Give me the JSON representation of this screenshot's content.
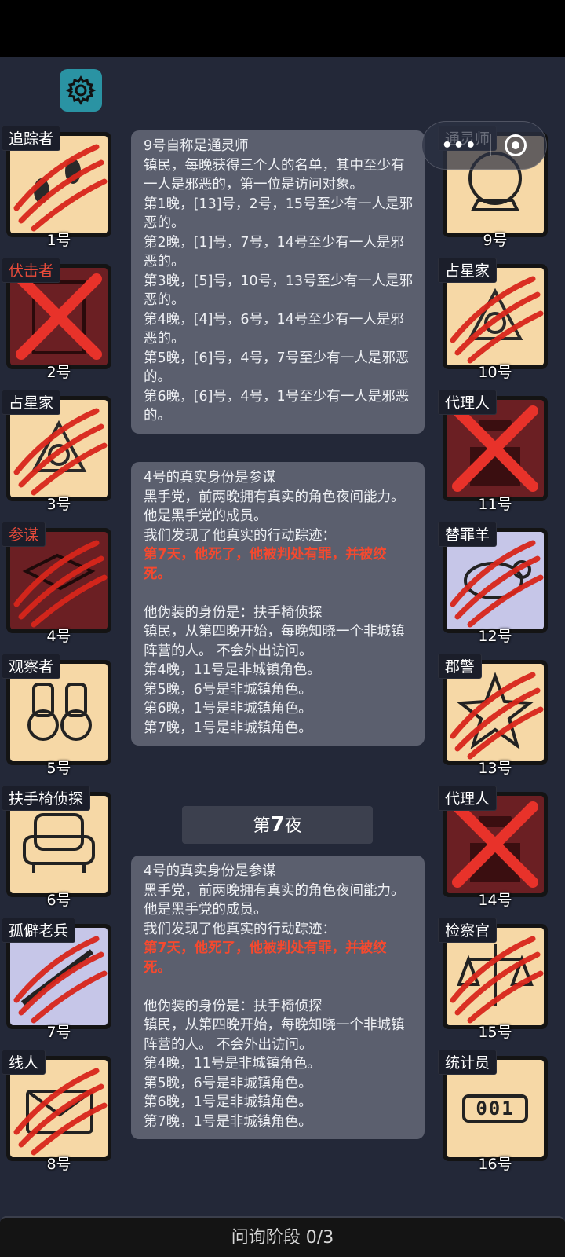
{
  "capsule": {
    "dots": "•••"
  },
  "left_cards": [
    {
      "role": "追踪者",
      "num": "1号",
      "red": false,
      "bg": "tan",
      "icon": "footprints-icon",
      "mark": "claw"
    },
    {
      "role": "伏击者",
      "num": "2号",
      "red": true,
      "bg": "red",
      "icon": "door-icon",
      "mark": "cross"
    },
    {
      "role": "占星家",
      "num": "3号",
      "red": false,
      "bg": "tan",
      "icon": "sextant-icon",
      "mark": "claw"
    },
    {
      "role": "参谋",
      "num": "4号",
      "red": true,
      "bg": "red",
      "icon": "map-icon",
      "mark": "claw"
    },
    {
      "role": "观察者",
      "num": "5号",
      "red": false,
      "bg": "tan",
      "icon": "binoculars-icon",
      "mark": "none"
    },
    {
      "role": "扶手椅侦探",
      "num": "6号",
      "red": false,
      "bg": "tan",
      "icon": "armchair-icon",
      "mark": "none"
    },
    {
      "role": "孤僻老兵",
      "num": "7号",
      "red": false,
      "bg": "blue",
      "icon": "rifle-icon",
      "mark": "claw"
    },
    {
      "role": "线人",
      "num": "8号",
      "red": false,
      "bg": "tan",
      "icon": "envelope-icon",
      "mark": "claw"
    }
  ],
  "right_cards": [
    {
      "role": "通灵师",
      "num": "9号",
      "red": false,
      "bg": "tan",
      "icon": "crystal-ball-icon",
      "mark": "none"
    },
    {
      "role": "占星家",
      "num": "10号",
      "red": false,
      "bg": "tan",
      "icon": "sextant-icon",
      "mark": "claw"
    },
    {
      "role": "代理人",
      "num": "11号",
      "red": false,
      "bg": "red",
      "icon": "agent-icon",
      "mark": "cross"
    },
    {
      "role": "替罪羊",
      "num": "12号",
      "red": false,
      "bg": "blue",
      "icon": "sheep-icon",
      "mark": "claw"
    },
    {
      "role": "郡警",
      "num": "13号",
      "red": false,
      "bg": "tan",
      "icon": "sheriff-badge-icon",
      "mark": "claw"
    },
    {
      "role": "代理人",
      "num": "14号",
      "red": false,
      "bg": "red",
      "icon": "agent-icon",
      "mark": "cross"
    },
    {
      "role": "检察官",
      "num": "15号",
      "red": false,
      "bg": "tan",
      "icon": "scales-icon",
      "mark": "claw"
    },
    {
      "role": "统计员",
      "num": "16号",
      "red": false,
      "bg": "tan",
      "icon": "counter-icon",
      "mark": "none",
      "counter": "001"
    }
  ],
  "panel1": {
    "text": "9号自称是通灵师\n镇民，每晚获得三个人的名单，其中至少有一人是邪恶的，第一位是访问对象。\n第1晚，[13]号，2号，15号至少有一人是邪恶的。\n第2晚，[1]号，7号，14号至少有一人是邪恶的。\n第3晚，[5]号，10号，13号至少有一人是邪恶的。\n第4晚，[4]号，6号，14号至少有一人是邪恶的。\n第5晚，[6]号，4号，7号至少有一人是邪恶的。\n第6晚，[6]号，4号，1号至少有一人是邪恶的。"
  },
  "panel2": {
    "pre": "4号的真实身份是参谋\n黑手党，前两晚拥有真实的角色夜间能力。\n他是黑手党的成员。\n我们发现了他真实的行动踪迹：",
    "highlight": "第7天，他死了，他被判处有罪，并被绞死。",
    "post": "\n他伪装的身份是：扶手椅侦探\n镇民，从第四晚开始，每晚知晓一个非城镇阵营的人。 不会外出访问。\n第4晚，11号是非城镇角色。\n第5晚，6号是非城镇角色。\n第6晚，1号是非城镇角色。\n第7晚，1号是非城镇角色。"
  },
  "night_label": {
    "prefix": "第",
    "num": "7",
    "suffix": "夜"
  },
  "panel3": {
    "pre": "4号的真实身份是参谋\n黑手党，前两晚拥有真实的角色夜间能力。\n他是黑手党的成员。\n我们发现了他真实的行动踪迹：",
    "highlight": "第7天，他死了，他被判处有罪，并被绞死。",
    "post": "\n他伪装的身份是：扶手椅侦探\n镇民，从第四晚开始，每晚知晓一个非城镇阵营的人。 不会外出访问。\n第4晚，11号是非城镇角色。\n第5晚，6号是非城镇角色。\n第6晚，1号是非城镇角色。\n第7晚，1号是非城镇角色。"
  },
  "footer": {
    "label": "问询阶段 0/3"
  }
}
